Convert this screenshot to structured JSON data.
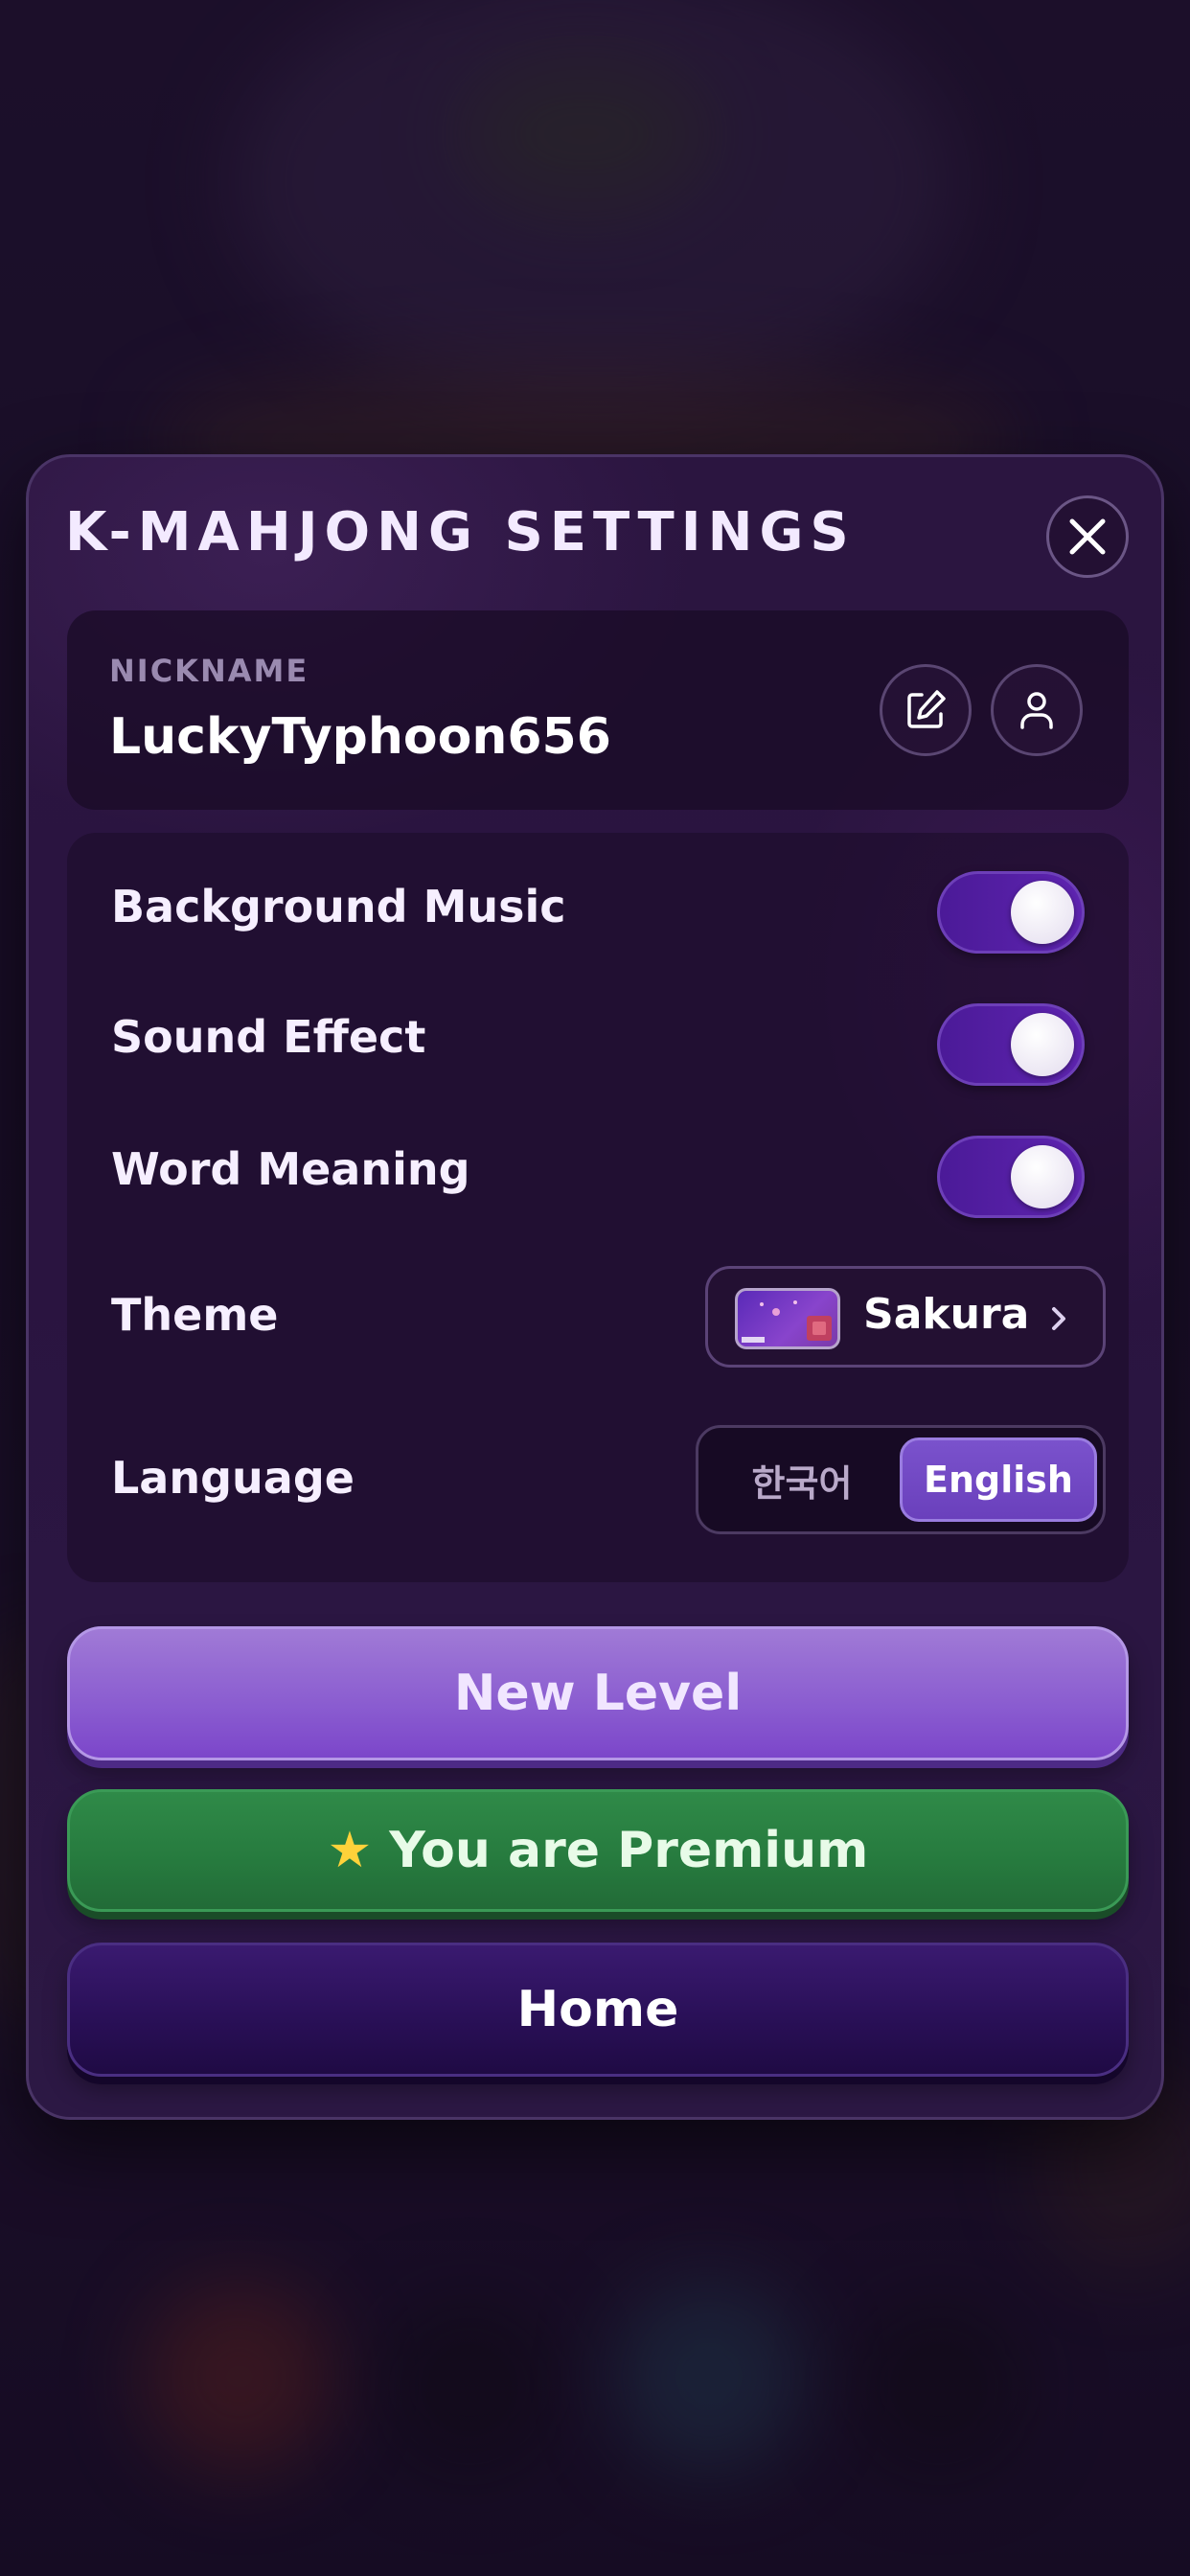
{
  "modal": {
    "title": "K-MAHJONG SETTINGS"
  },
  "nickname": {
    "label": "NICKNAME",
    "value": "LuckyTyphoon656"
  },
  "settings": {
    "background_music": {
      "label": "Background Music",
      "on": true
    },
    "sound_effect": {
      "label": "Sound Effect",
      "on": true
    },
    "word_meaning": {
      "label": "Word Meaning",
      "on": true
    },
    "theme": {
      "label": "Theme",
      "value": "Sakura"
    },
    "language": {
      "label": "Language",
      "options": [
        "한국어",
        "English"
      ],
      "selected": "English"
    }
  },
  "buttons": {
    "new_level": "New Level",
    "premium": "You are Premium",
    "premium_icon": "star-icon",
    "home": "Home"
  },
  "colors": {
    "toggle_on": "#5e24b0",
    "new_level": "#8a5cd0",
    "premium": "#267a3e",
    "home": "#2a1058"
  }
}
